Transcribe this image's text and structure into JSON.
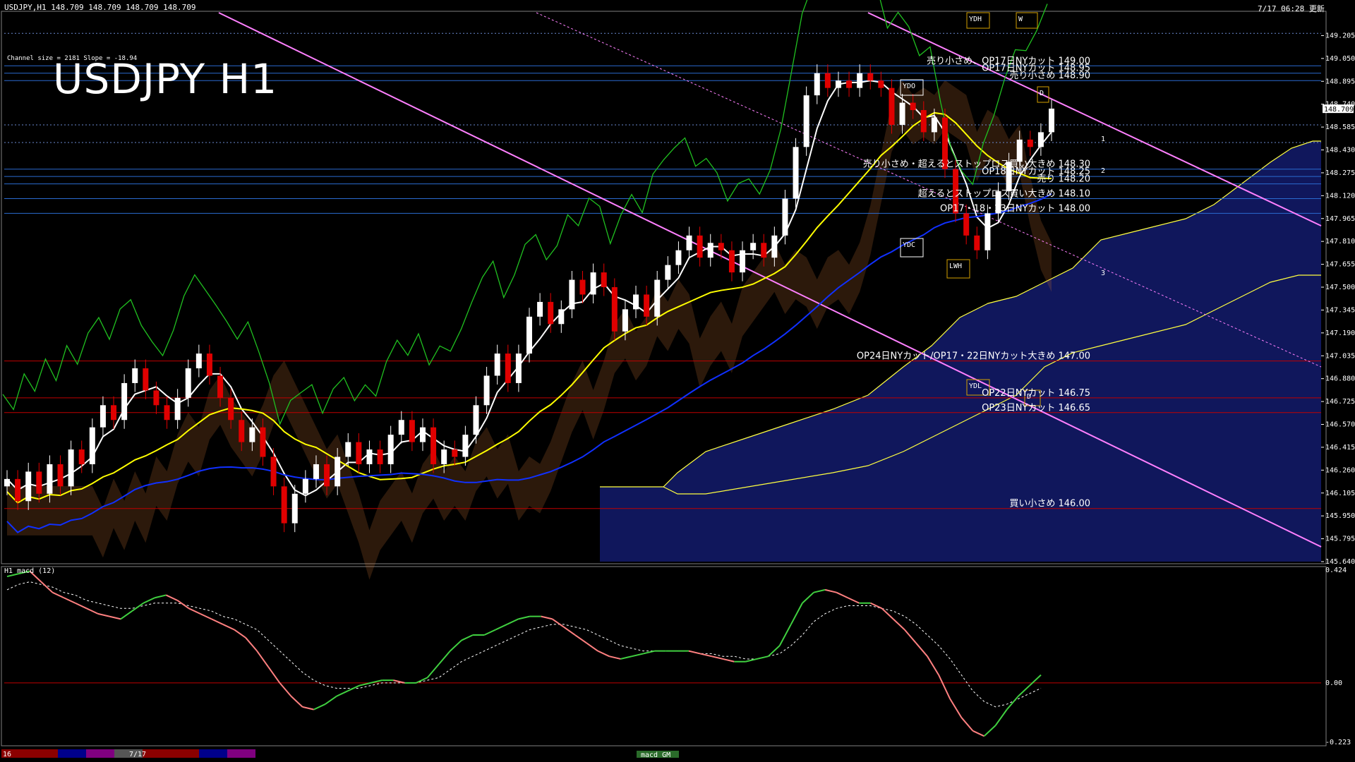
{
  "header": {
    "symbol_info": "USDJPY,H1  148.709 148.709 148.709 148.709",
    "updated": "7/17 06:28 更新",
    "channel_info": "Channel size = 2181 Slope = -18.94",
    "big_title": "USDJPY H1",
    "macd_label": "H1  macd (12)",
    "bottom_date_left": "16",
    "bottom_date_mid": "7/17",
    "bottom_macd_tag": "macd GM"
  },
  "colors": {
    "background": "#000000",
    "up_candle": "#ffffff",
    "down_candle": "#e00000",
    "cloud": "#1d2aa8",
    "sma_fast": "#ffffff",
    "sma_mid": "#ffff00",
    "sma_slow": "#1030ff",
    "chikou": "#20c020",
    "channel": "#ff80ff",
    "macd_up": "#40d040",
    "macd_down": "#ff8080",
    "hline_blue": "#2a6bd0",
    "hline_red": "#c00000"
  },
  "chart_data": [
    {
      "type": "candlestick",
      "title": "USDJPY H1",
      "ylim": [
        145.64,
        149.36
      ],
      "current_price": 148.709,
      "yticks": [
        149.205,
        149.05,
        148.895,
        148.74,
        148.585,
        148.43,
        148.275,
        148.12,
        147.965,
        147.81,
        147.655,
        147.5,
        147.345,
        147.19,
        147.035,
        146.88,
        146.725,
        146.57,
        146.415,
        146.26,
        146.105,
        145.95,
        145.795,
        145.64
      ],
      "ytick_labels": [
        "149.205",
        "149.050",
        "148.895",
        "148.740",
        "148.585",
        "148.430",
        "148.275",
        "148.120",
        "147.965",
        "147.810",
        "147.655",
        "147.500",
        "147.345",
        "147.190",
        "147.035",
        "146.880",
        "146.725",
        "146.570",
        "146.415",
        "146.260",
        "146.105",
        "145.950",
        "145.795",
        "145.640"
      ],
      "current_label": "148.709",
      "series_close": [
        146.2,
        146.05,
        146.25,
        146.1,
        146.3,
        146.15,
        146.4,
        146.3,
        146.55,
        146.7,
        146.6,
        146.85,
        146.95,
        146.8,
        146.7,
        146.6,
        146.75,
        146.95,
        147.05,
        146.9,
        146.75,
        146.6,
        146.45,
        146.55,
        146.35,
        146.15,
        145.9,
        146.1,
        146.2,
        146.3,
        146.15,
        146.35,
        146.45,
        146.3,
        146.4,
        146.3,
        146.5,
        146.6,
        146.45,
        146.55,
        146.3,
        146.4,
        146.35,
        146.5,
        146.7,
        146.9,
        147.05,
        146.85,
        147.05,
        147.3,
        147.4,
        147.25,
        147.35,
        147.55,
        147.45,
        147.6,
        147.5,
        147.2,
        147.35,
        147.45,
        147.3,
        147.55,
        147.65,
        147.75,
        147.85,
        147.7,
        147.8,
        147.75,
        147.6,
        147.75,
        147.8,
        147.7,
        147.85,
        148.1,
        148.45,
        148.8,
        148.95,
        148.85,
        148.9,
        148.85,
        148.95,
        148.9,
        148.85,
        148.6,
        148.75,
        148.7,
        148.55,
        148.65,
        148.3,
        148.0,
        147.85,
        147.75,
        148.0,
        148.15,
        148.35,
        148.5,
        148.45,
        148.55,
        148.71
      ],
      "ohlc_note": "approximate hourly candles",
      "horizontal_lines": [
        {
          "price": 149.0,
          "label": "売り小さめ、OP17日NYカット 149.00",
          "color": "blue"
        },
        {
          "price": 148.95,
          "label": "OP17日NYカット 148.95",
          "color": "blue"
        },
        {
          "price": 148.9,
          "label": "売り小さめ 148.90",
          "color": "blue"
        },
        {
          "price": 148.3,
          "label": "売り小さめ・超えるとストップロス買い大きめ 148.30",
          "color": "blue"
        },
        {
          "price": 148.25,
          "label": "OP18日NYカット 148.25",
          "color": "blue"
        },
        {
          "price": 148.2,
          "label": "売り 148.20",
          "color": "blue"
        },
        {
          "price": 148.1,
          "label": "超えるとストップロス買い大きめ 148.10",
          "color": "blue"
        },
        {
          "price": 148.0,
          "label": "OP17・18・23日NYカット 148.00",
          "color": "blue"
        },
        {
          "price": 147.0,
          "label": "OP24日NYカット/OP17・22日NYカット大きめ 147.00",
          "color": "red"
        },
        {
          "price": 146.75,
          "label": "OP22日NYカット 146.75",
          "color": "red"
        },
        {
          "price": 146.65,
          "label": "OP23日NYカット 146.65",
          "color": "red"
        },
        {
          "price": 146.0,
          "label": "買い小さめ 146.00",
          "color": "red"
        }
      ],
      "box_labels": [
        "YDH",
        "W",
        "YDO",
        "D",
        "YDC",
        "LWH",
        "YDL",
        "D"
      ],
      "target_labels": [
        "1",
        "2",
        "3"
      ]
    },
    {
      "type": "line",
      "title": "H1  macd (12)",
      "ylim": [
        -0.223,
        0.424
      ],
      "ytick_labels": [
        "0.424",
        "0.00",
        "-0.223"
      ],
      "macd": [
        0.4,
        0.41,
        0.42,
        0.38,
        0.34,
        0.32,
        0.3,
        0.28,
        0.26,
        0.25,
        0.24,
        0.27,
        0.3,
        0.32,
        0.33,
        0.31,
        0.28,
        0.26,
        0.24,
        0.22,
        0.2,
        0.17,
        0.12,
        0.06,
        0.0,
        -0.05,
        -0.09,
        -0.1,
        -0.08,
        -0.05,
        -0.03,
        -0.01,
        0.0,
        0.01,
        0.01,
        0.0,
        0.0,
        0.02,
        0.07,
        0.12,
        0.16,
        0.18,
        0.18,
        0.2,
        0.22,
        0.24,
        0.25,
        0.25,
        0.24,
        0.21,
        0.18,
        0.15,
        0.12,
        0.1,
        0.09,
        0.1,
        0.11,
        0.12,
        0.12,
        0.12,
        0.12,
        0.11,
        0.1,
        0.09,
        0.08,
        0.08,
        0.09,
        0.1,
        0.14,
        0.22,
        0.3,
        0.34,
        0.35,
        0.34,
        0.32,
        0.3,
        0.3,
        0.28,
        0.24,
        0.2,
        0.15,
        0.1,
        0.03,
        -0.06,
        -0.13,
        -0.18,
        -0.2,
        -0.16,
        -0.1,
        -0.05,
        -0.01,
        0.03
      ],
      "signal": [
        0.35,
        0.37,
        0.38,
        0.37,
        0.36,
        0.34,
        0.33,
        0.31,
        0.3,
        0.29,
        0.28,
        0.28,
        0.29,
        0.3,
        0.3,
        0.3,
        0.29,
        0.28,
        0.27,
        0.25,
        0.24,
        0.22,
        0.2,
        0.16,
        0.12,
        0.08,
        0.04,
        0.01,
        -0.01,
        -0.02,
        -0.02,
        -0.02,
        -0.01,
        0.0,
        0.0,
        0.0,
        0.0,
        0.01,
        0.02,
        0.05,
        0.08,
        0.1,
        0.12,
        0.14,
        0.16,
        0.18,
        0.2,
        0.21,
        0.22,
        0.22,
        0.21,
        0.2,
        0.18,
        0.16,
        0.14,
        0.13,
        0.12,
        0.12,
        0.12,
        0.12,
        0.12,
        0.11,
        0.11,
        0.1,
        0.1,
        0.09,
        0.09,
        0.1,
        0.11,
        0.14,
        0.18,
        0.23,
        0.26,
        0.28,
        0.29,
        0.29,
        0.29,
        0.28,
        0.27,
        0.25,
        0.22,
        0.18,
        0.14,
        0.09,
        0.03,
        -0.03,
        -0.07,
        -0.09,
        -0.08,
        -0.06,
        -0.04,
        -0.02
      ]
    }
  ]
}
